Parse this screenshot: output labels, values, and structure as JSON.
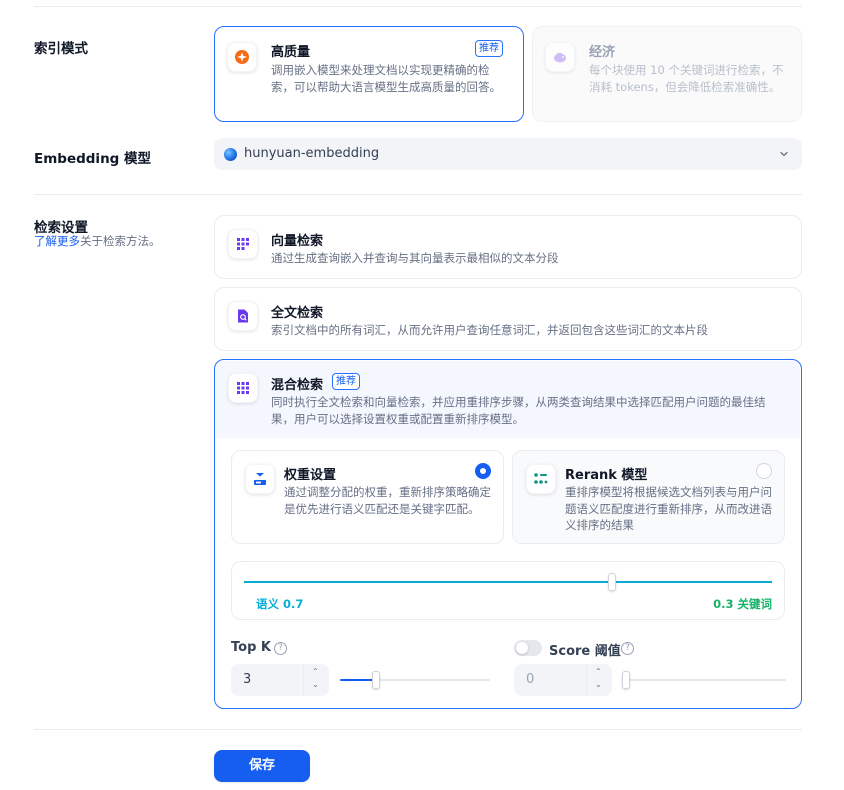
{
  "index_mode": {
    "label": "索引模式",
    "high_quality": {
      "title": "高质量",
      "badge": "推荐",
      "desc": "调用嵌入模型来处理文档以实现更精确的检索，可以帮助大语言模型生成高质量的回答。",
      "icon": "sparkle-icon"
    },
    "economy": {
      "title": "经济",
      "desc": "每个块使用 10 个关键词进行检索，不消耗 tokens，但会降低检索准确性。",
      "icon": "piggy-bank-icon"
    }
  },
  "embedding": {
    "label": "Embedding 模型",
    "value": "hunyuan-embedding"
  },
  "retrieval": {
    "label": "检索设置",
    "learn_more": "了解更多",
    "learn_more_suffix": "关于检索方法。",
    "vector": {
      "title": "向量检索",
      "desc": "通过生成查询嵌入并查询与其向量表示最相似的文本分段"
    },
    "fulltext": {
      "title": "全文检索",
      "desc": "索引文档中的所有词汇，从而允许用户查询任意词汇，并返回包含这些词汇的文本片段"
    },
    "hybrid": {
      "title": "混合检索",
      "badge": "推荐",
      "desc": "同时执行全文检索和向量检索，并应用重排序步骤，从两类查询结果中选择匹配用户问题的最佳结果，用户可以选择设置权重或配置重新排序模型。",
      "weight": {
        "title": "权重设置",
        "desc": "通过调整分配的权重，重新排序策略确定是优先进行语义匹配还是关键字匹配。",
        "selected": true
      },
      "rerank": {
        "title": "Rerank 模型",
        "desc": "重排序模型将根据候选文档列表与用户问题语义匹配度进行重新排序，从而改进语义排序的结果",
        "selected": false
      },
      "semantic_label": "语义 0.7",
      "keyword_label": "0.3 关键词",
      "semantic_weight": 0.7,
      "keyword_weight": 0.3
    },
    "top_k": {
      "label": "Top K",
      "value": "3",
      "help": "?"
    },
    "score": {
      "label": "Score 阈值",
      "value": "0",
      "help": "?",
      "enabled": false
    }
  },
  "actions": {
    "save": "保存"
  },
  "colors": {
    "primary": "#155eef",
    "semantic": "#06aed4",
    "keyword": "#17b26a"
  }
}
